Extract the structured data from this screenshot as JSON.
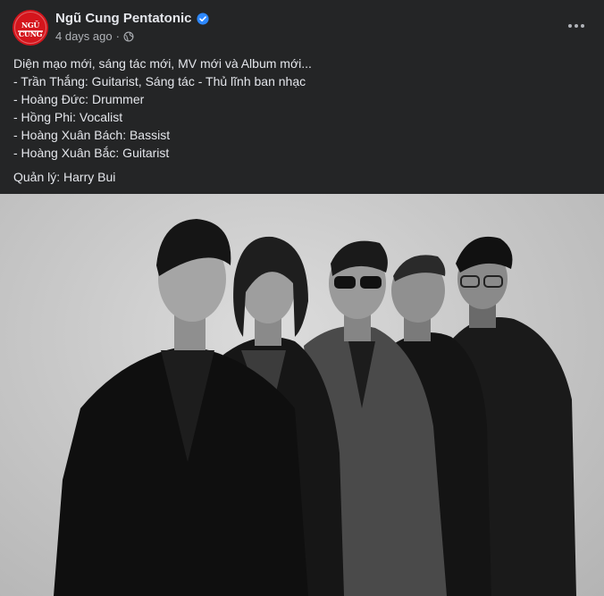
{
  "post": {
    "page_name": "Ngũ Cung Pentatonic",
    "timestamp": "4 days ago",
    "separator": "·",
    "privacy_icon": "globe-icon",
    "verified_icon": "verified-badge-icon",
    "more_icon": "more-options-icon",
    "avatar_text": "NGŨ CUNG",
    "text": {
      "lines": [
        "Diện mạo mới, sáng tác mới, MV mới và Album mới...",
        "- Trần Thắng: Guitarist, Sáng tác - Thủ lĩnh ban nhạc",
        "- Hoàng Đức: Drummer",
        "- Hồng Phi: Vocalist",
        "- Hoàng Xuân Bách: Bassist",
        "- Hoàng Xuân Bắc: Guitarist"
      ],
      "manager": "Quản lý: Harry Bui"
    }
  },
  "colors": {
    "background": "#242526",
    "primary_text": "#e4e6eb",
    "secondary_text": "#b0b3b8",
    "verified_blue": "#2d88ff",
    "avatar_red": "#d4151c"
  }
}
